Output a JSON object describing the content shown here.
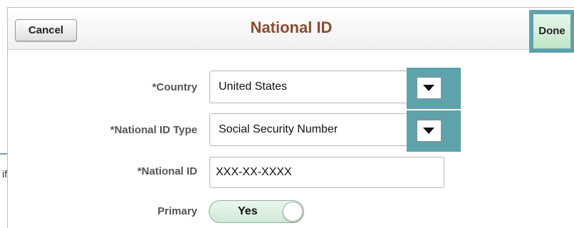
{
  "background": {
    "partial_text": "if"
  },
  "dialog": {
    "title": "National ID",
    "cancel_label": "Cancel",
    "done_label": "Done"
  },
  "form": {
    "country": {
      "label": "*Country",
      "value": "United States"
    },
    "id_type": {
      "label": "*National ID Type",
      "value": "Social Security Number"
    },
    "national_id": {
      "label": "*National ID",
      "value": "XXX-XX-XXXX"
    },
    "primary": {
      "label": "Primary",
      "value": "Yes"
    }
  },
  "colors": {
    "title": "#8b4c2f",
    "highlight": "#5ea3ab",
    "toggle_on": "#cfe9d7"
  },
  "icons": {
    "dropdown": "chevron-down-icon"
  }
}
